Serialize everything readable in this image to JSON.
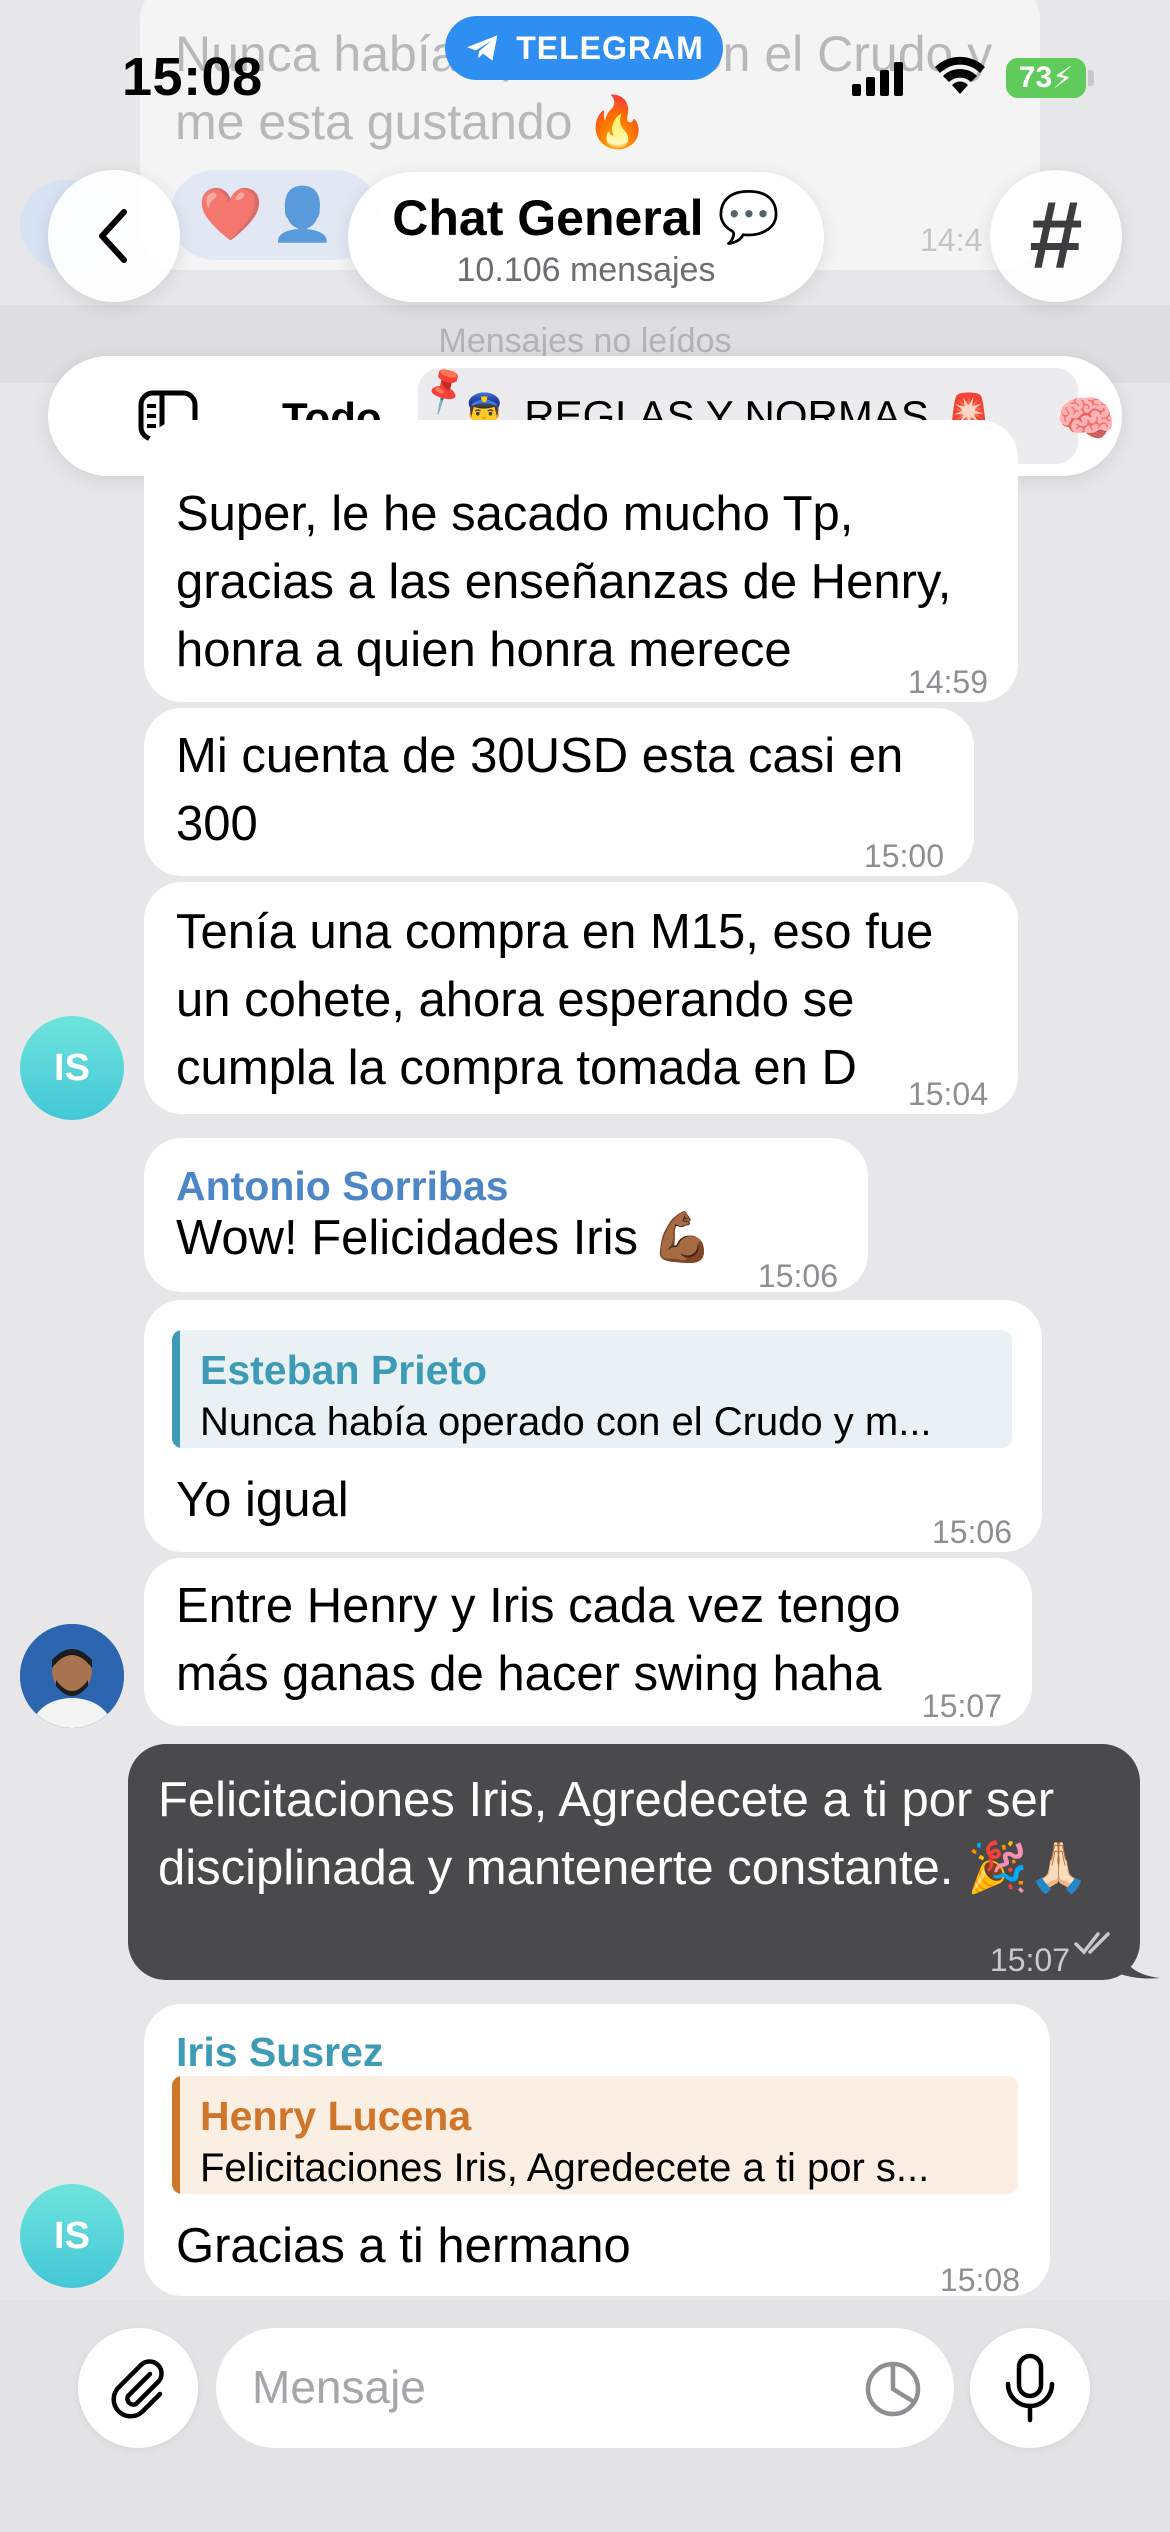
{
  "status_bar": {
    "time": "15:08",
    "app_badge": "TELEGRAM",
    "battery": "73"
  },
  "background": {
    "faded_text": "Nunca había operado con el Crudo y me esta gustando 🔥",
    "faded_time": "14:4",
    "unread_label": "Mensajes no leídos"
  },
  "header": {
    "title": "Chat General",
    "title_icon": "💬",
    "subtitle": "10.106 mensajes"
  },
  "topics": {
    "all_label": "Todo",
    "active_label": "REGLAS Y NORMAS",
    "active_emoji_left": "👮‍♂️",
    "active_emoji_right": "🚨",
    "next_emoji": "🧠"
  },
  "messages": [
    {
      "text": "Super, le he sacado mucho Tp, gracias a las enseñanzas de Henry, honra a quien honra merece",
      "time": "14:59"
    },
    {
      "text": "Mi cuenta de 30USD esta casi en 300",
      "time": "15:00"
    },
    {
      "text": "Tenía una compra en M15, eso fue un cohete, ahora esperando se cumpla la compra tomada en D",
      "time": "15:04",
      "avatar": "IS"
    },
    {
      "sender": "Antonio Sorribas",
      "text": "Wow! Felicidades Iris 💪🏾",
      "time": "15:06"
    },
    {
      "reply_name": "Esteban Prieto",
      "reply_snippet": "Nunca había operado con el Crudo y m...",
      "text": "Yo igual",
      "time": "15:06"
    },
    {
      "text": "Entre Henry y Iris cada vez tengo más ganas de hacer swing haha",
      "time": "15:07"
    },
    {
      "outgoing": true,
      "text": "Felicitaciones Iris, Agredecete a ti por ser disciplinada y mantenerte constante. 🎉🙏🏻",
      "time": "15:07"
    },
    {
      "sender": "Iris Susrez",
      "reply_name": "Henry Lucena",
      "reply_snippet": "Felicitaciones Iris, Agredecete a ti por s...",
      "text": "Gracias a ti hermano",
      "time": "15:08",
      "avatar": "IS"
    }
  ],
  "input": {
    "placeholder": "Mensaje"
  },
  "colors": {
    "background": "#e7e7ea",
    "outgoing_bubble": "#4a4a4c",
    "sender_blue": "#4d86c6",
    "sender_teal": "#3e9bb5",
    "reply_orange": "#d0762a",
    "telegram_blue": "#2e8ef2",
    "avatar_teal": "#43c7d8"
  }
}
